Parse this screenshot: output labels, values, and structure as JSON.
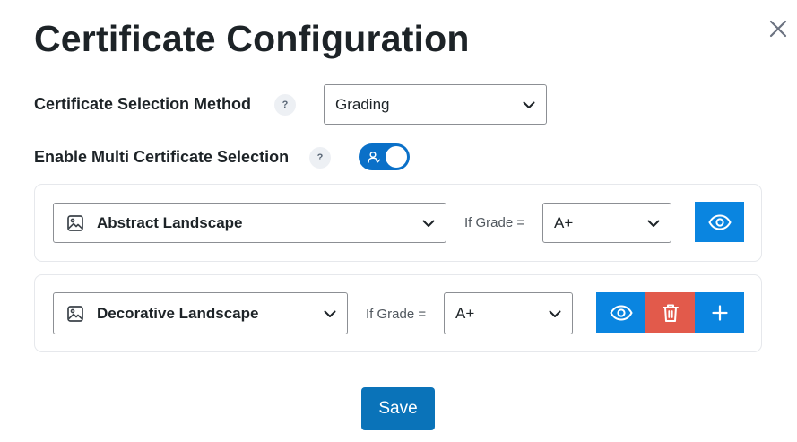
{
  "modal": {
    "title": "Certificate Configuration",
    "close_icon": "close-icon"
  },
  "selection_method": {
    "label": "Certificate Selection Method",
    "help": "?",
    "value": "Grading"
  },
  "multi_selection": {
    "label": "Enable Multi Certificate Selection",
    "help": "?",
    "enabled": true,
    "toggle_icon": "user-icon"
  },
  "certificates": [
    {
      "template_icon": "image-icon",
      "template": "Abstract Landscape",
      "condition_label": "If Grade =",
      "grade": "A+",
      "actions": [
        "preview"
      ]
    },
    {
      "template_icon": "image-icon",
      "template": "Decorative Landscape",
      "condition_label": "If Grade =",
      "grade": "A+",
      "actions": [
        "preview",
        "delete",
        "add"
      ]
    }
  ],
  "footer": {
    "save_label": "Save"
  },
  "colors": {
    "primary": "#0a85e0",
    "toggle": "#0a70c8",
    "danger": "#e25a4b",
    "save": "#0a73b9",
    "text": "#1d2327"
  }
}
